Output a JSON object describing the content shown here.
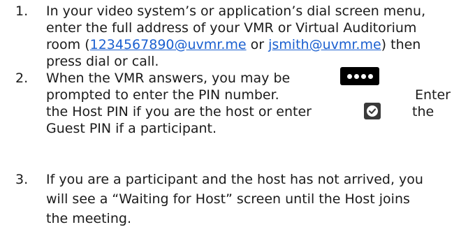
{
  "steps": [
    {
      "number": "1.",
      "line1": "In your video system’s or application’s dial screen menu,",
      "line2": "enter the full address of your VMR or Virtual Auditorium",
      "line3_prefix": "room (",
      "link1": "1234567890@uvmr.me",
      "line3_mid": " or ",
      "link2": "jsmith@uvmr.me",
      "line3_suffix": ") then",
      "line4": "press dial or call."
    },
    {
      "number": "2.",
      "line1": "When the VMR answers, you may be",
      "line2": "prompted to enter the PIN number.",
      "line2_right": "Enter",
      "line3": "the Host PIN if you are the host or enter",
      "line3_right": "the",
      "line4": "Guest PIN if a participant."
    },
    {
      "number": "3.",
      "line1": "If you are a participant and the host has not arrived, you",
      "line2": "will see a “Waiting for Host” screen until the Host joins",
      "line3": "the meeting."
    }
  ],
  "icons": {
    "keypad": "pin-keypad-icon",
    "check": "checkmark-icon"
  },
  "colors": {
    "link": "#1a5fd0",
    "text": "#1a1a1a"
  }
}
